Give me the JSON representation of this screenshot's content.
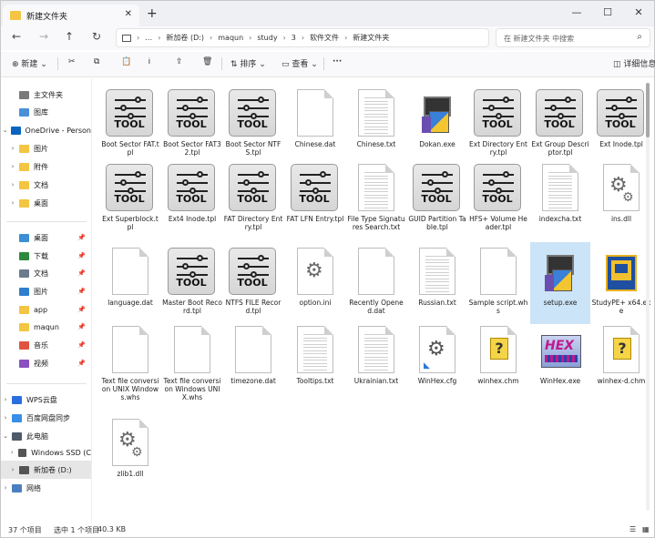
{
  "tab": {
    "title": "新建文件夹",
    "close": "✕",
    "new_tab": "+"
  },
  "window_controls": {
    "minimize": "—",
    "maximize": "☐",
    "close": "✕"
  },
  "nav": {
    "back": "←",
    "forward": "→",
    "up": "↑",
    "refresh": "↻",
    "expand": "›",
    "more": "…"
  },
  "breadcrumb": [
    "新加卷 (D:)",
    "maqun",
    "study",
    "3",
    "软件文件",
    "新建文件夹"
  ],
  "search": {
    "placeholder": "在 新建文件夹 中搜索",
    "icon": "search-icon"
  },
  "toolbar": {
    "new_label": "新建",
    "sort_label": "排序",
    "view_label": "查看",
    "more_label": "···",
    "details_label": "详细信息"
  },
  "sidebar": {
    "items": [
      {
        "label": "主文件夹",
        "chevron": "",
        "icon": "home-icon",
        "pin": ""
      },
      {
        "label": "图库",
        "chevron": "",
        "icon": "gallery-icon",
        "pin": ""
      },
      {
        "label": "OneDrive - Person",
        "chevron": "⌄",
        "icon": "cloud-icon",
        "pin": ""
      },
      {
        "label": "图片",
        "chevron": "›",
        "icon": "folder-icon",
        "pin": ""
      },
      {
        "label": "附件",
        "chevron": "›",
        "icon": "folder-icon",
        "pin": ""
      },
      {
        "label": "文档",
        "chevron": "›",
        "icon": "folder-icon",
        "pin": ""
      },
      {
        "label": "桌面",
        "chevron": "›",
        "icon": "folder-icon",
        "pin": ""
      },
      {
        "label": "桌面",
        "chevron": "",
        "icon": "desktop-icon",
        "pin": "📌"
      },
      {
        "label": "下载",
        "chevron": "",
        "icon": "download-icon",
        "pin": "📌"
      },
      {
        "label": "文档",
        "chevron": "",
        "icon": "document-icon",
        "pin": "📌"
      },
      {
        "label": "图片",
        "chevron": "",
        "icon": "pictures-icon",
        "pin": "📌"
      },
      {
        "label": "app",
        "chevron": "",
        "icon": "folder-icon",
        "pin": "📌"
      },
      {
        "label": "maqun",
        "chevron": "",
        "icon": "folder-icon",
        "pin": "📌"
      },
      {
        "label": "音乐",
        "chevron": "",
        "icon": "music-icon",
        "pin": "📌"
      },
      {
        "label": "视频",
        "chevron": "",
        "icon": "video-icon",
        "pin": "📌"
      },
      {
        "label": "WPS云盘",
        "chevron": "›",
        "icon": "wps-cloud-icon",
        "pin": ""
      },
      {
        "label": "百度网盘同步",
        "chevron": "›",
        "icon": "baidu-icon",
        "pin": ""
      },
      {
        "label": "此电脑",
        "chevron": "⌄",
        "icon": "computer-icon",
        "pin": ""
      },
      {
        "label": "Windows SSD (C",
        "chevron": "›",
        "icon": "drive-icon",
        "pin": ""
      },
      {
        "label": "新加卷 (D:)",
        "chevron": "›",
        "icon": "drive-icon",
        "pin": ""
      },
      {
        "label": "网络",
        "chevron": "›",
        "icon": "network-icon",
        "pin": ""
      }
    ]
  },
  "files": [
    {
      "name": "Boot Sector FAT.tpl",
      "kind": "tool"
    },
    {
      "name": "Boot Sector FAT32.tpl",
      "kind": "tool"
    },
    {
      "name": "Boot Sector NTFS.tpl",
      "kind": "tool"
    },
    {
      "name": "Chinese.dat",
      "kind": "blank"
    },
    {
      "name": "Chinese.txt",
      "kind": "text"
    },
    {
      "name": "Dokan.exe",
      "kind": "installer"
    },
    {
      "name": "Ext Directory Entry.tpl",
      "kind": "tool"
    },
    {
      "name": "Ext Group Descriptor.tpl",
      "kind": "tool"
    },
    {
      "name": "Ext Inode.tpl",
      "kind": "tool"
    },
    {
      "name": "Ext Superblock.tpl",
      "kind": "tool"
    },
    {
      "name": "Ext4 Inode.tpl",
      "kind": "tool"
    },
    {
      "name": "FAT Directory Entry.tpl",
      "kind": "tool"
    },
    {
      "name": "FAT LFN Entry.tpl",
      "kind": "tool"
    },
    {
      "name": "File Type Signatures Search.txt",
      "kind": "text"
    },
    {
      "name": "GUID Partition Table.tpl",
      "kind": "tool"
    },
    {
      "name": "HFS+ Volume Header.tpl",
      "kind": "tool"
    },
    {
      "name": "indexcha.txt",
      "kind": "text"
    },
    {
      "name": "ins.dll",
      "kind": "dll"
    },
    {
      "name": "language.dat",
      "kind": "blank"
    },
    {
      "name": "Master Boot Record.tpl",
      "kind": "tool"
    },
    {
      "name": "NTFS FILE Record.tpl",
      "kind": "tool"
    },
    {
      "name": "option.ini",
      "kind": "ini"
    },
    {
      "name": "Recently Opened.dat",
      "kind": "blank"
    },
    {
      "name": "Russian.txt",
      "kind": "text"
    },
    {
      "name": "Sample script.whs",
      "kind": "blank"
    },
    {
      "name": "setup.exe",
      "kind": "installer",
      "selected": true
    },
    {
      "name": "StudyPE+ x64.exe",
      "kind": "studype"
    },
    {
      "name": "Text file conversion UNIX Windows.whs",
      "kind": "blank"
    },
    {
      "name": "Text file conversion Windows UNIX.whs",
      "kind": "blank"
    },
    {
      "name": "timezone.dat",
      "kind": "blank"
    },
    {
      "name": "Tooltips.txt",
      "kind": "text"
    },
    {
      "name": "Ukrainian.txt",
      "kind": "text"
    },
    {
      "name": "WinHex.cfg",
      "kind": "cfg"
    },
    {
      "name": "winhex.chm",
      "kind": "chm"
    },
    {
      "name": "WinHex.exe",
      "kind": "hexexe"
    },
    {
      "name": "winhex-d.chm",
      "kind": "chm"
    },
    {
      "name": "zlib1.dll",
      "kind": "dll"
    }
  ],
  "tool_text": "TOOL",
  "status": {
    "count": "37 个项目",
    "selected": "选中 1 个项目",
    "size": "40.3 KB"
  },
  "colors": {
    "accent": "#0067c0",
    "selection": "#cce4f7",
    "folder": "#f4c542"
  }
}
